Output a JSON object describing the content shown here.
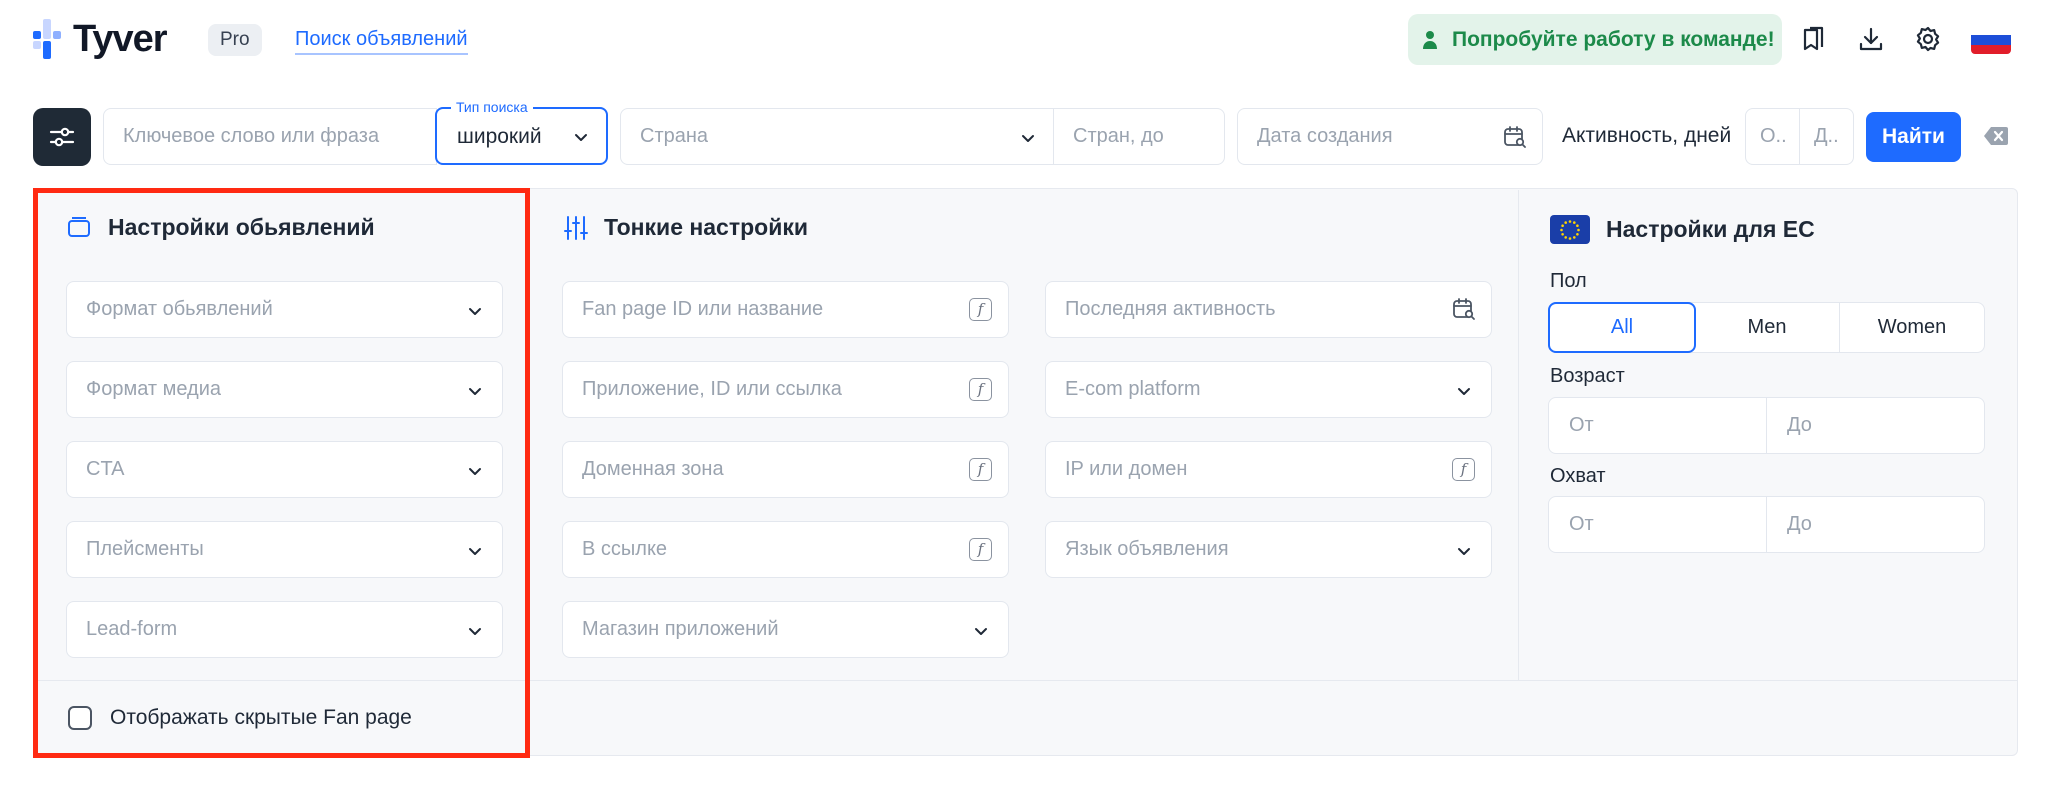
{
  "header": {
    "logo_text": "Tyver",
    "badge": "Pro",
    "nav_link": "Поиск объявлений",
    "team_button": "Попробуйте работу в команде!",
    "icons": [
      "bookmarks-icon",
      "download-icon",
      "settings-icon",
      "language-flag-ru"
    ]
  },
  "search": {
    "keyword_placeholder": "Ключевое слово или фраза",
    "search_type_label": "Тип поиска",
    "search_type_value": "широкий",
    "country_placeholder": "Страна",
    "countries_to_placeholder": "Стран, до",
    "date_placeholder": "Дата создания",
    "activity_label": "Активность, дней",
    "activity_from_placeholder": "О..",
    "activity_to_placeholder": "Д..",
    "find_button": "Найти"
  },
  "ad_settings": {
    "title": "Настройки обьявлений",
    "fields": [
      "Формат обьявлений",
      "Формат медиа",
      "CTA",
      "Плейсменты",
      "Lead-form"
    ],
    "checkbox_label": "Отображать скрытые Fan page"
  },
  "fine_settings": {
    "title": "Тонкие настройки",
    "left_fields": [
      "Fan page ID или название",
      "Приложение, ID или ссылка",
      "Доменная зона",
      "В ссылке",
      "Магазин приложений"
    ],
    "right_fields": [
      "Последняя активность",
      "E-com platform",
      "IP или домен",
      "Язык объявления"
    ]
  },
  "eu_settings": {
    "title": "Настройки для ЕС",
    "gender_label": "Пол",
    "gender_options": [
      "All",
      "Men",
      "Women"
    ],
    "gender_selected": "All",
    "age_label": "Возраст",
    "age_from": "От",
    "age_to": "До",
    "reach_label": "Охват",
    "reach_from": "От",
    "reach_to": "До"
  },
  "colors": {
    "accent": "#1e6bff",
    "highlight_border": "#ff2a12",
    "team_green": "#1c8a4a"
  }
}
